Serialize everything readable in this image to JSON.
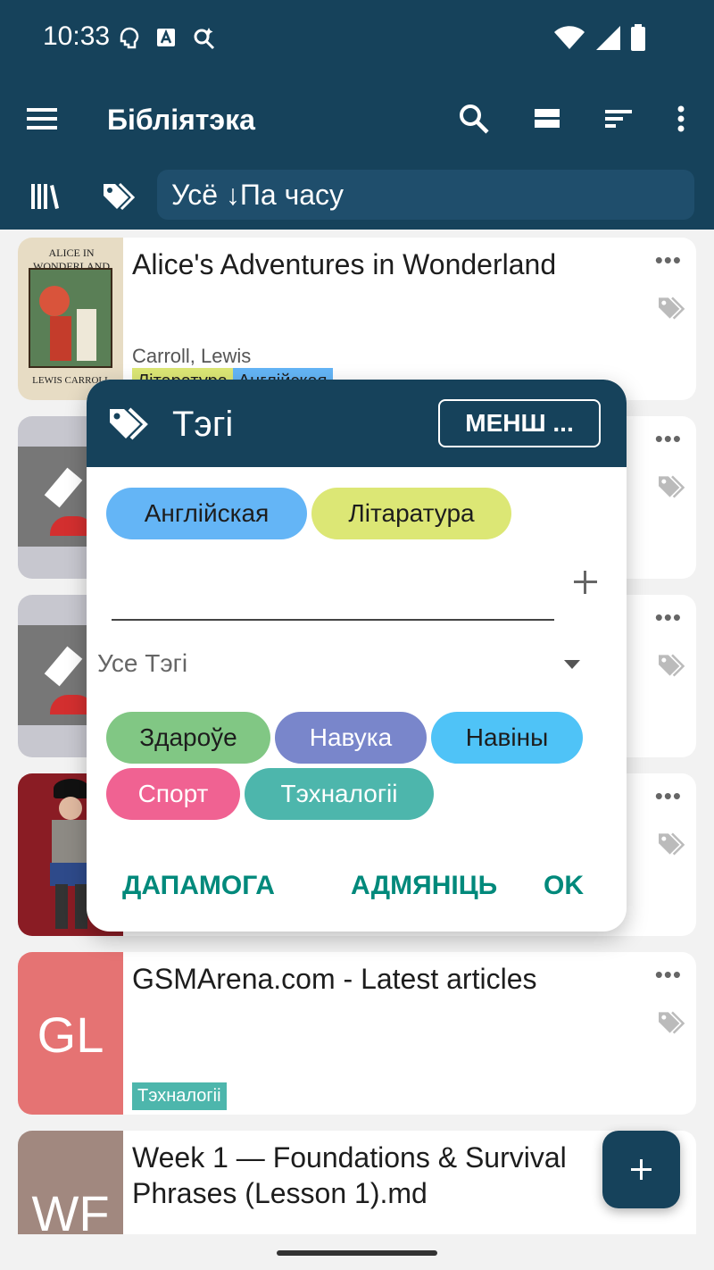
{
  "status_bar": {
    "time": "10:33"
  },
  "app_bar": {
    "title": "Бібліятэка"
  },
  "filter": {
    "label": "Усё ↓Па часу"
  },
  "books": [
    {
      "title": "Alice's Adventures in Wonderland",
      "author": "Carroll, Lewis",
      "cover_text_top": "ALICE IN WONDERLAND",
      "cover_text_bottom": "LEWIS CARROLL",
      "tags": [
        "Літаратура",
        "Англійская"
      ]
    },
    {
      "title": "",
      "author": "",
      "tags": []
    },
    {
      "title": "",
      "author": "",
      "tags": []
    },
    {
      "title": "",
      "author": "",
      "tags": []
    },
    {
      "title": "GSMArena.com - Latest articles",
      "initials": "GL",
      "tags": [
        "Тэхналогіі"
      ]
    },
    {
      "title": "Week 1 — Foundations & Survival Phrases (Lesson 1).md",
      "initials": "WF",
      "tags": []
    }
  ],
  "dialog": {
    "title": "Тэгі",
    "header_button": "МЕНШ ...",
    "selected_tags": [
      {
        "label": "Англійская",
        "color": "#64b5f6"
      },
      {
        "label": "Літаратура",
        "color": "#dce775"
      }
    ],
    "all_tags_label": "Усе Тэгі",
    "available_tags": [
      {
        "label": "Здароўе",
        "color": "#81c784"
      },
      {
        "label": "Навука",
        "color": "#7986cb"
      },
      {
        "label": "Навіны",
        "color": "#4fc3f7"
      },
      {
        "label": "Спорт",
        "color": "#f06292"
      },
      {
        "label": "Тэхналогіі",
        "color": "#4db6ac"
      }
    ],
    "actions": {
      "help": "ДАПАМОГА",
      "cancel": "АДМЯНІЦЬ",
      "ok": "OK"
    }
  },
  "colors": {
    "primary": "#16425b",
    "accent": "#00897b"
  }
}
